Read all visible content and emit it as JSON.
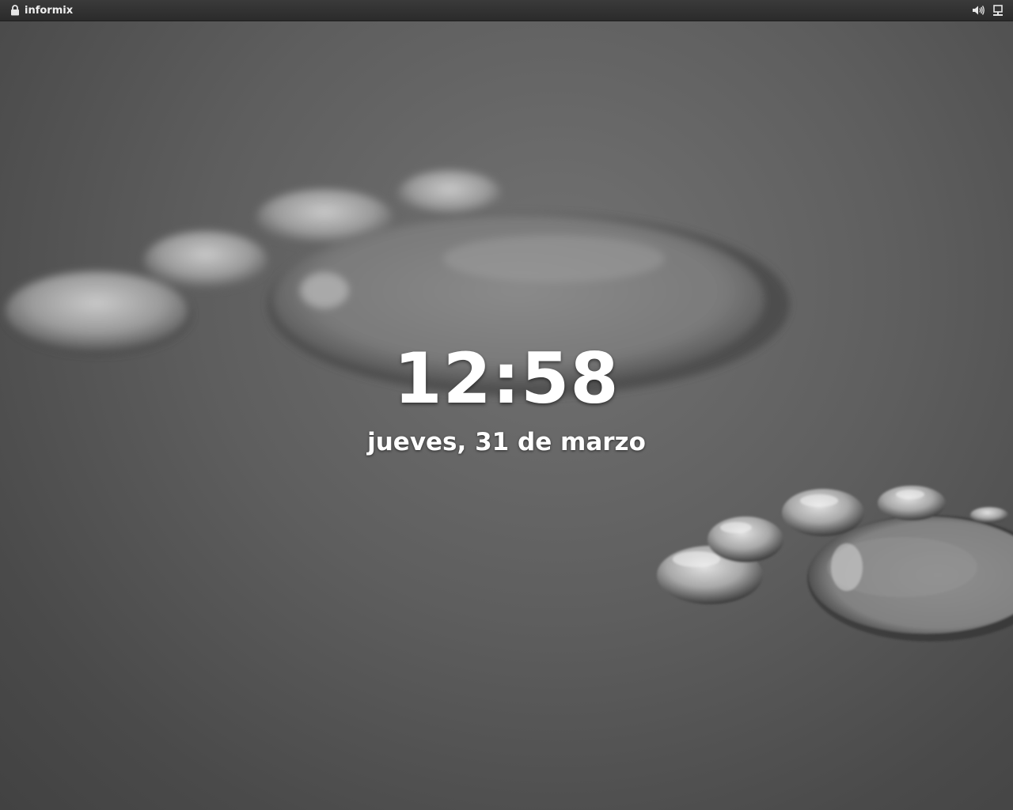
{
  "topbar": {
    "username": "informix",
    "left_icon": "lock-icon",
    "right_icons": [
      "volume-icon",
      "network-icon"
    ]
  },
  "lockscreen": {
    "time": "12:58",
    "date": "jueves, 31 de marzo"
  },
  "colors": {
    "topbar_bg": "#2f2f2f",
    "text": "#ffffff",
    "wallpaper": "#5e5e5e"
  }
}
